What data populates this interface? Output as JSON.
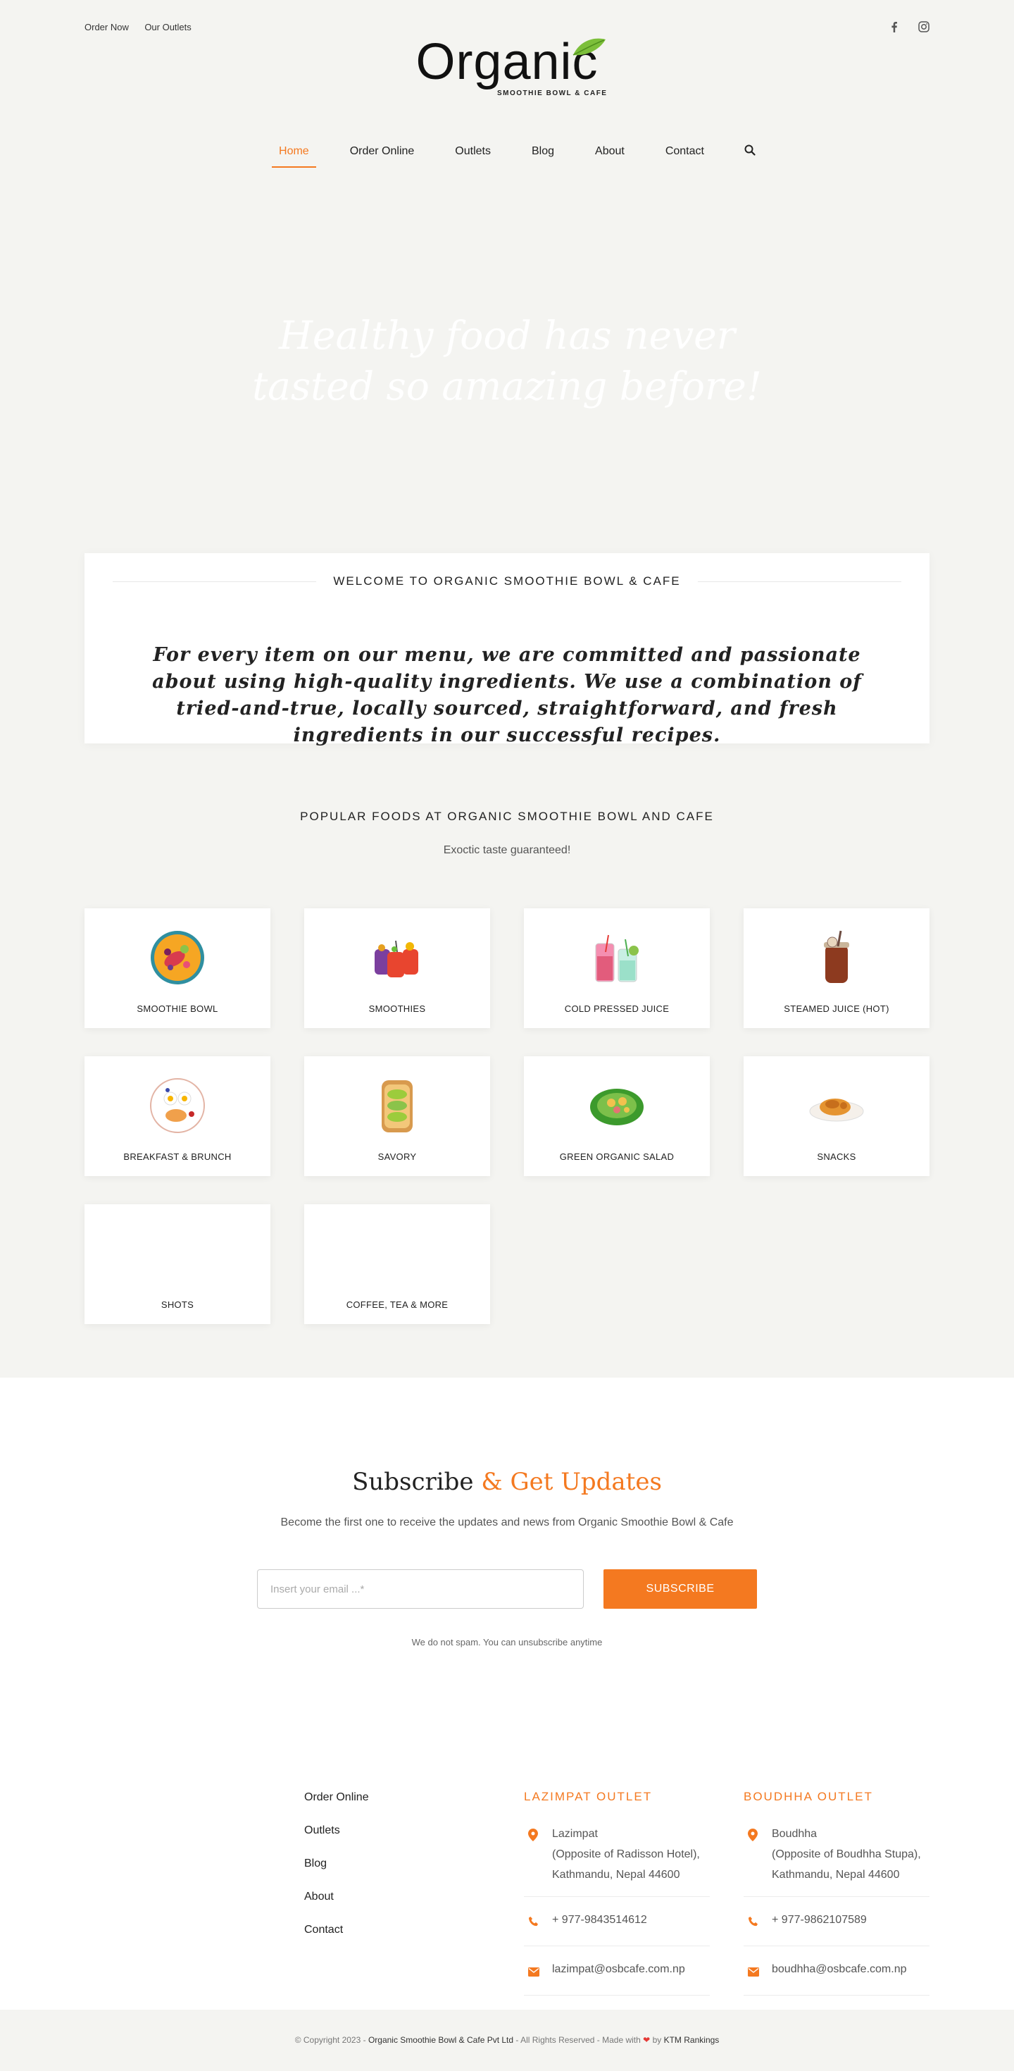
{
  "topbar": {
    "order_now": "Order Now",
    "outlets": "Our Outlets"
  },
  "social": {
    "facebook": "facebook-icon",
    "instagram": "instagram-icon"
  },
  "logo": {
    "word": "Organic",
    "sub": "SMOOTHIE BOWL & CAFE"
  },
  "nav": {
    "items": [
      {
        "label": "Home",
        "active": true
      },
      {
        "label": "Order Online"
      },
      {
        "label": "Outlets"
      },
      {
        "label": "Blog"
      },
      {
        "label": "About"
      },
      {
        "label": "Contact"
      }
    ],
    "search_icon": "search-icon"
  },
  "hero": {
    "line1": "Healthy food has never",
    "line2": "tasted so amazing before!"
  },
  "welcome": {
    "heading": "WELCOME TO ORGANIC SMOOTHIE BOWL & CAFE",
    "body": "For every item on our menu, we are committed and passionate about using high-quality ingredients. We use a combination of tried-and-true, locally sourced, straightforward, and fresh ingredients in our successful recipes."
  },
  "popular": {
    "title": "POPULAR FOODS AT ORGANIC SMOOTHIE BOWL AND CAFE",
    "subtitle": "Exoctic taste guaranteed!"
  },
  "foods": [
    {
      "label": "SMOOTHIE BOWL",
      "icon": "smoothie-bowl-icon"
    },
    {
      "label": "SMOOTHIES",
      "icon": "smoothies-icon"
    },
    {
      "label": "COLD PRESSED JUICE",
      "icon": "cold-juice-icon"
    },
    {
      "label": "STEAMED JUICE (HOT)",
      "icon": "hot-juice-icon"
    },
    {
      "label": "BREAKFAST & BRUNCH",
      "icon": "breakfast-icon"
    },
    {
      "label": "SAVORY",
      "icon": "avocado-toast-icon"
    },
    {
      "label": "GREEN ORGANIC SALAD",
      "icon": "salad-icon"
    },
    {
      "label": "SNACKS",
      "icon": "snacks-icon"
    },
    {
      "label": "SHOTS",
      "icon": ""
    },
    {
      "label": "COFFEE, TEA & MORE",
      "icon": ""
    }
  ],
  "subscribe": {
    "title": "Subscribe",
    "title_accent": "& Get Updates",
    "desc": "Become the first one to receive the updates and news from Organic Smoothie Bowl & Cafe",
    "placeholder": "Insert your email ...*",
    "button": "SUBSCRIBE",
    "note": "We do not spam. You can unsubscribe anytime"
  },
  "footer": {
    "links": [
      "Order Online",
      "Outlets",
      "Blog",
      "About",
      "Contact"
    ],
    "lazimpat": {
      "title": "LAZIMPAT OUTLET",
      "address1": "Lazimpat",
      "address2": "(Opposite of Radisson Hotel),",
      "address3": "Kathmandu, Nepal 44600",
      "phone": "+ 977-9843514612",
      "email": "lazimpat@osbcafe.com.np"
    },
    "boudhha": {
      "title": "BOUDHHA OUTLET",
      "address1": "Boudhha",
      "address2": "(Opposite of Boudhha Stupa),",
      "address3": "Kathmandu, Nepal 44600",
      "phone": "+ 977-9862107589",
      "email": "boudhha@osbcafe.com.np"
    }
  },
  "copyright": {
    "prefix": "© Copyright 2023 -",
    "company": "Organic Smoothie Bowl & Cafe Pvt Ltd",
    "middle": "- All Rights Reserved - Made with",
    "by": "by",
    "agency": "KTM Rankings"
  },
  "colors": {
    "accent": "#f47920",
    "background": "#f4f4f1"
  }
}
